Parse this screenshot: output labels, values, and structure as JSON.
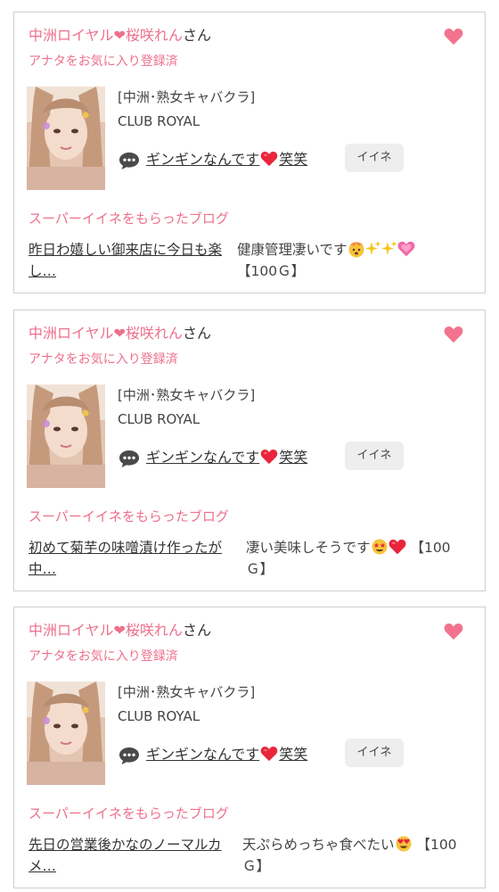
{
  "cards": [
    {
      "cast_name": "中洲ロイヤル❤桜咲れん",
      "suffix": "さん",
      "favorite_status": "アナタをお気に入り登録済",
      "shop_name": "[中洲･熟女キャバクラ]",
      "club_name": "CLUB ROYAL",
      "catch_before": "ギンギンなんです",
      "catch_after": "笑笑",
      "iine_label": "イイネ",
      "section_title": "スーパーイイネをもらったブログ",
      "blog_title": "昨日わ嬉しい御来店に今日も楽し…",
      "comment_line1": "健康管理凄いです",
      "comment_line2": "【100Ｇ】"
    },
    {
      "cast_name": "中洲ロイヤル❤桜咲れん",
      "suffix": "さん",
      "favorite_status": "アナタをお気に入り登録済",
      "shop_name": "[中洲･熟女キャバクラ]",
      "club_name": "CLUB ROYAL",
      "catch_before": "ギンギンなんです",
      "catch_after": "笑笑",
      "iine_label": "イイネ",
      "section_title": "スーパーイイネをもらったブログ",
      "blog_title": "初めて菊芋の味噌漬け作ったが中…",
      "comment_line1": "凄い美味しそうです",
      "comment_tail": "【100",
      "comment_line2": "Ｇ】"
    },
    {
      "cast_name": "中洲ロイヤル❤桜咲れん",
      "suffix": "さん",
      "favorite_status": "アナタをお気に入り登録済",
      "shop_name": "[中洲･熟女キャバクラ]",
      "club_name": "CLUB ROYAL",
      "catch_before": "ギンギンなんです",
      "catch_after": "笑笑",
      "iine_label": "イイネ",
      "section_title": "スーパーイイネをもらったブログ",
      "blog_title": "先日の営業後かなのノーマルカメ…",
      "comment_line1": "天ぷらめっちゃ食べたい",
      "comment_tail": "【100",
      "comment_line2": "Ｇ】"
    }
  ],
  "icons": {
    "favorite": "heart-icon",
    "comment": "speech-bubble-icon",
    "inline_heart": "red-heart-emoji",
    "card1_emoji": [
      "exploding-head-emoji",
      "sparkles-emoji",
      "sparkles-emoji",
      "growing-heart-emoji"
    ],
    "card2_emoji": [
      "star-struck-emoji",
      "red-heart-emoji"
    ],
    "card3_emoji": [
      "heart-eyes-emoji"
    ]
  },
  "colors": {
    "accent_pink": "#ee6f8c",
    "heart_red": "#e8253a",
    "border": "#cfcfcf",
    "button_bg": "#eeeeee"
  }
}
